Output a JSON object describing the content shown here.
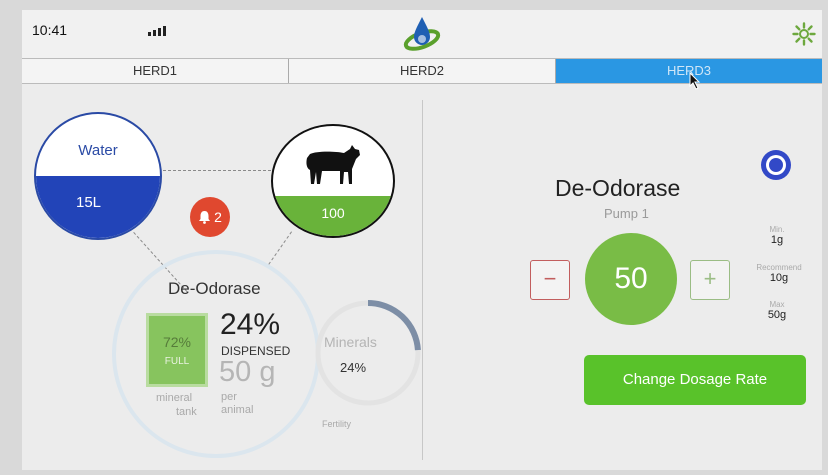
{
  "status": {
    "time": "10:41"
  },
  "tabs": [
    {
      "label": "HERD1",
      "active": false
    },
    {
      "label": "HERD2",
      "active": false
    },
    {
      "label": "HERD3",
      "active": true
    }
  ],
  "water": {
    "label": "Water",
    "value": "15L",
    "fill_fraction": 0.5
  },
  "herd": {
    "value": "100",
    "fill_fraction": 0.36
  },
  "alerts": {
    "count": "2"
  },
  "product": {
    "name": "De-Odorase",
    "tank_percent": "72%",
    "tank_status": "FULL",
    "tank_label_1": "mineral",
    "tank_label_2": "tank",
    "dispensed_percent": "24%",
    "dispensed_label": "DISPENSED",
    "amount": "50 g",
    "amount_label_1": "per",
    "amount_label_2": "animal"
  },
  "minerals": {
    "label": "Minerals",
    "value": "24%",
    "fraction": 0.24,
    "footer": "Fertility"
  },
  "pump": {
    "title": "De-Odorase",
    "subtitle": "Pump 1",
    "dose": "50",
    "minus": "−",
    "plus": "+",
    "min_label": "Min.",
    "min_value": "1g",
    "rec_label": "Recommend",
    "rec_value": "10g",
    "max_label": "Max",
    "max_value": "50g",
    "change_button": "Change Dosage Rate"
  },
  "colors": {
    "accent_blue": "#2a97e3",
    "water_blue": "#2244b8",
    "green": "#69b33a",
    "button_green": "#59c22a",
    "alert_red": "#e0482f"
  }
}
